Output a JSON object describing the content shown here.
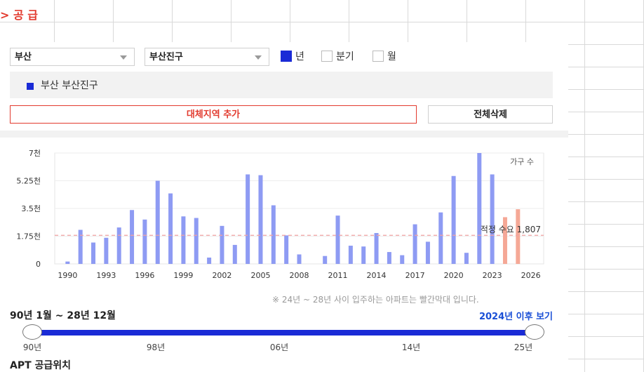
{
  "section_title": "> 공 급",
  "filters": {
    "region": "부산",
    "district": "부산진구",
    "period_options": [
      {
        "label": "년",
        "checked": true
      },
      {
        "label": "분기",
        "checked": false
      },
      {
        "label": "월",
        "checked": false
      }
    ]
  },
  "legend": {
    "label": "부산 부산진구",
    "color": "#1a2bd6"
  },
  "buttons": {
    "add_region": "대체지역 추가",
    "delete_all": "전체삭제"
  },
  "chart_data": {
    "type": "bar",
    "unit_label": "가구 수",
    "y_ticks": [
      "0",
      "1.75천",
      "3.5천",
      "5.25천",
      "7천"
    ],
    "ylim": [
      0,
      7000
    ],
    "x_ticks": [
      "1990",
      "1993",
      "1996",
      "1999",
      "2002",
      "2005",
      "2008",
      "2011",
      "2014",
      "2017",
      "2020",
      "2023",
      "2026"
    ],
    "xlim": [
      1989,
      2027
    ],
    "reference_line": {
      "label": "적정 수요 1,807",
      "value": 1807
    },
    "series": [
      {
        "highlight_from": 2024,
        "colors": {
          "normal": "#8e9bf3",
          "future": "#f5a896"
        },
        "x": [
          1990,
          1991,
          1992,
          1993,
          1994,
          1995,
          1996,
          1997,
          1998,
          1999,
          2000,
          2001,
          2002,
          2003,
          2004,
          2005,
          2006,
          2007,
          2008,
          2010,
          2011,
          2012,
          2013,
          2014,
          2015,
          2016,
          2017,
          2018,
          2019,
          2020,
          2021,
          2022,
          2023,
          2024,
          2025
        ],
        "values": [
          150,
          2150,
          1350,
          1650,
          2300,
          3400,
          2800,
          5250,
          4450,
          3000,
          2900,
          400,
          2400,
          1200,
          5650,
          5600,
          3700,
          1800,
          600,
          500,
          3050,
          1150,
          1100,
          1950,
          750,
          550,
          2500,
          1400,
          3250,
          5550,
          700,
          7000,
          5650,
          2950,
          3450
        ]
      }
    ]
  },
  "note": "※ 24년 ~ 28년 사이 입주하는 아파트는 빨간막대 입니다.",
  "range": {
    "label": "90년 1월 ~ 28년 12월",
    "after_link": "2024년 이후 보기",
    "ticks": [
      "90년",
      "98년",
      "06년",
      "14년",
      "25년"
    ]
  },
  "bottom_title": "APT 공급위치"
}
